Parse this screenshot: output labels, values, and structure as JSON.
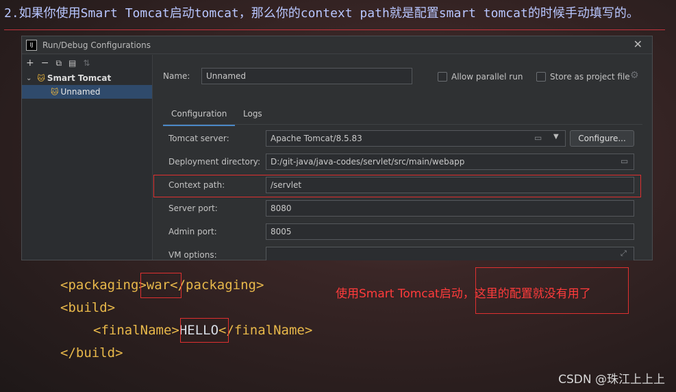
{
  "header": {
    "text": "2.如果你使用Smart Tomcat启动tomcat，那么你的context path就是配置smart tomcat的时候手动填写的。"
  },
  "dialog": {
    "title": "Run/Debug Configurations",
    "app_icon_text": "IJ",
    "close_glyph": "✕",
    "toolbar_icons": [
      "plus-icon",
      "minus-icon",
      "copy-icon",
      "folder-add-icon",
      "sort-icon"
    ],
    "toolbar_glyphs": [
      "+",
      "−",
      "⧉",
      "▤",
      "⇅"
    ],
    "tree": {
      "root_label": "Smart Tomcat",
      "child_label": "Unnamed"
    },
    "name_label": "Name:",
    "name_value": "Unnamed",
    "allow_parallel_label": "Allow parallel run",
    "store_as_project_label": "Store as project file",
    "tabs": [
      "Configuration",
      "Logs"
    ],
    "fields": {
      "tomcat_server_label": "Tomcat server:",
      "tomcat_server_value": "Apache Tomcat/8.5.83",
      "configure_button": "Configure...",
      "deploy_dir_label": "Deployment directory:",
      "deploy_dir_value": "D:/git-java/java-codes/servlet/src/main/webapp",
      "context_path_label": "Context path:",
      "context_path_value": "/servlet",
      "server_port_label": "Server port:",
      "server_port_value": "8080",
      "admin_port_label": "Admin port:",
      "admin_port_value": "8005",
      "vm_options_label": "VM options:",
      "vm_options_value": ""
    }
  },
  "code": {
    "line1_open": "<packaging>",
    "line1_value": "war",
    "line1_close": "</packaging>",
    "line2": "<build>",
    "line3_open": "<finalName>",
    "line3_value": "HELLO",
    "line3_close": "</finalName>",
    "line4": "</build>"
  },
  "note": "使用Smart Tomcat启动，这里的配置就没有用了",
  "watermark": "CSDN @珠江上上上"
}
